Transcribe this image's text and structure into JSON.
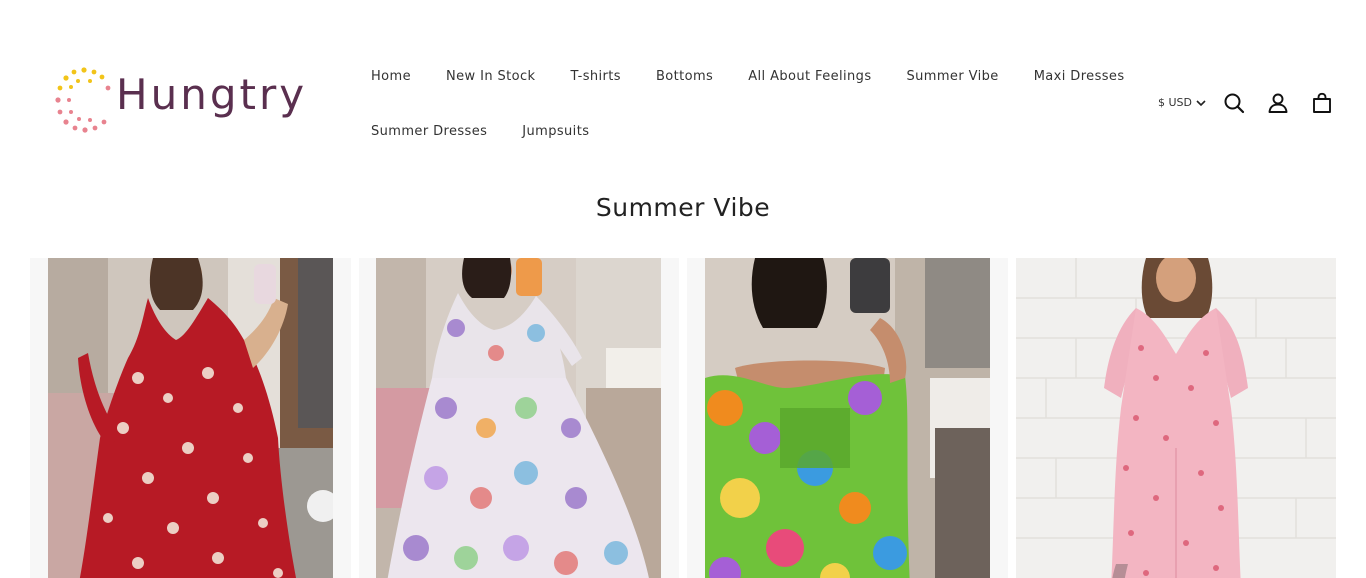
{
  "brand": {
    "name": "Hungtry"
  },
  "nav": {
    "row1": [
      "Home",
      "New In Stock",
      "T-shirts",
      "Bottoms",
      "All About Feelings",
      "Summer Vibe",
      "Maxi Dresses"
    ],
    "row2": [
      "Summer Dresses",
      "Jumpsuits"
    ]
  },
  "header": {
    "currency": "$ USD"
  },
  "section": {
    "title": "Summer Vibe"
  },
  "products": [
    {
      "image": "red-white-patterned-maxi-dress"
    },
    {
      "image": "floral-purple-maxi-dress"
    },
    {
      "image": "green-multicolor-off-shoulder-dress"
    },
    {
      "image": "pink-leopard-jumpsuit"
    }
  ],
  "colors": {
    "logo_text": "#5a2f4f",
    "logo_dots_pink": "#e8838f",
    "logo_dots_yellow": "#f2c419"
  }
}
